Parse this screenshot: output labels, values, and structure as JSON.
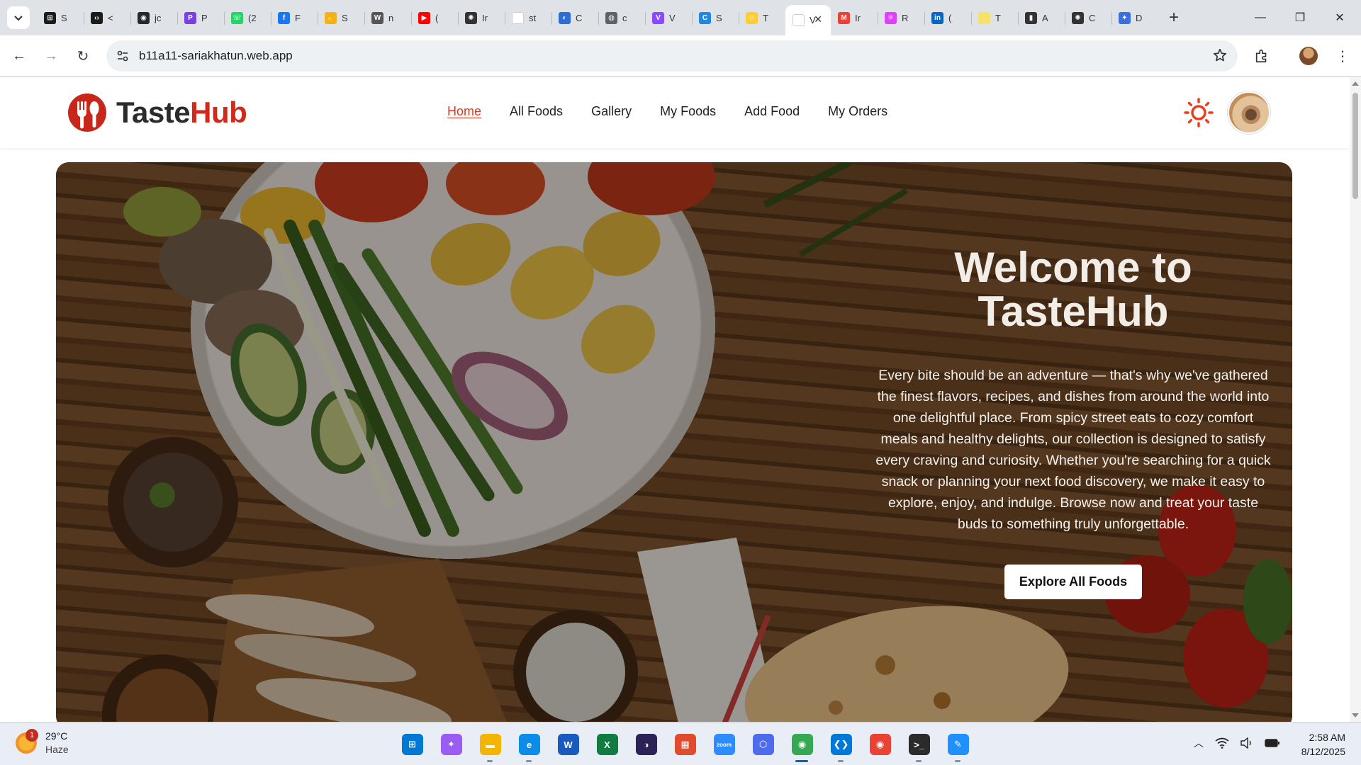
{
  "browser": {
    "tabs": [
      {
        "icon": "codechef-icon",
        "label": "S",
        "color": "#1b1b1b",
        "glyph": "⊞"
      },
      {
        "icon": "code-icon",
        "label": "<",
        "color": "#1b1b1b",
        "glyph": "‹›"
      },
      {
        "icon": "github-icon",
        "label": "jc",
        "color": "#24292e",
        "glyph": "◉"
      },
      {
        "icon": "p-icon",
        "label": "P",
        "color": "#7b3fe4",
        "glyph": "P"
      },
      {
        "icon": "whatsapp-icon",
        "label": "(2",
        "color": "#25d366",
        "glyph": "☏"
      },
      {
        "icon": "facebook-icon",
        "label": "F",
        "color": "#1877f2",
        "glyph": "f"
      },
      {
        "icon": "hands-icon",
        "label": "S",
        "color": "#f2b21b",
        "glyph": "✋"
      },
      {
        "icon": "wordpress-icon",
        "label": "n",
        "color": "#555555",
        "glyph": "W"
      },
      {
        "icon": "youtube-icon",
        "label": "(",
        "color": "#ff0000",
        "glyph": "▶"
      },
      {
        "icon": "openai-icon",
        "label": "Ir",
        "color": "#333333",
        "glyph": "✺"
      },
      {
        "icon": "blank-page-icon",
        "label": "st",
        "color": "#ffffff",
        "glyph": ""
      },
      {
        "icon": "copilot-icon",
        "label": "C",
        "color": "#2b6fd6",
        "glyph": "◐"
      },
      {
        "icon": "globe-icon",
        "label": "c",
        "color": "#5f6368",
        "glyph": "◍"
      },
      {
        "icon": "vite-icon",
        "label": "V",
        "color": "#8a4bff",
        "glyph": "V"
      },
      {
        "icon": "c-logo-icon",
        "label": "S",
        "color": "#1e88e5",
        "glyph": "C"
      },
      {
        "icon": "emoji-icon",
        "label": "T",
        "color": "#ffcc33",
        "glyph": "☺"
      },
      {
        "icon": "vite-page-icon",
        "label": "V",
        "color": "#ffffff",
        "glyph": ""
      },
      {
        "icon": "gmail-icon",
        "label": "Ir",
        "color": "#ea4335",
        "glyph": "M"
      },
      {
        "icon": "react-icon",
        "label": "R",
        "color": "#e040fb",
        "glyph": "⚛"
      },
      {
        "icon": "linkedin-icon",
        "label": "(",
        "color": "#0a66c2",
        "glyph": "in"
      },
      {
        "icon": "yellow-dot-icon",
        "label": "T",
        "color": "#f5e26b",
        "glyph": ""
      },
      {
        "icon": "bottle-icon",
        "label": "A",
        "color": "#333333",
        "glyph": "▮"
      },
      {
        "icon": "openai-icon-2",
        "label": "C",
        "color": "#333333",
        "glyph": "✺"
      },
      {
        "icon": "gemini-icon",
        "label": "D",
        "color": "#3b6fe0",
        "glyph": "✦"
      }
    ],
    "active_tab_index": 16,
    "address": "b11a11-sariakhatun.web.app"
  },
  "site": {
    "logo": {
      "part1": "Taste",
      "part2": "Hub"
    },
    "nav": [
      "Home",
      "All Foods",
      "Gallery",
      "My Foods",
      "Add Food",
      "My Orders"
    ],
    "active_nav": "Home"
  },
  "hero": {
    "title": "Welcome to TasteHub",
    "text": "Every bite should be an adventure — that's why we've gathered the finest flavors, recipes, and dishes from around the world into one delightful place. From spicy street eats to cozy comfort meals and healthy delights, our collection is designed to satisfy every craving and curiosity. Whether you're searching for a quick snack or planning your next food discovery, we make it easy to explore, enjoy, and indulge. Browse now and treat your taste buds to something truly unforgettable.",
    "button": "Explore All Foods"
  },
  "taskbar": {
    "weather": {
      "temp": "29°C",
      "condition": "Haze",
      "badge": "1"
    },
    "apps": [
      {
        "name": "start-icon",
        "color": "#0078d4",
        "glyph": "⊞"
      },
      {
        "name": "copilot-app-icon",
        "color": "#9b5cf6",
        "glyph": "✦"
      },
      {
        "name": "file-explorer-icon",
        "color": "#f4b400",
        "glyph": "▬"
      },
      {
        "name": "edge-icon",
        "color": "#0c8ce9",
        "glyph": "e"
      },
      {
        "name": "word-icon",
        "color": "#185abd",
        "glyph": "W"
      },
      {
        "name": "excel-icon",
        "color": "#107c41",
        "glyph": "X"
      },
      {
        "name": "eclipse-icon",
        "color": "#2c2255",
        "glyph": "◑"
      },
      {
        "name": "store-icon",
        "color": "#e04b2d",
        "glyph": "▦"
      },
      {
        "name": "zoom-icon",
        "color": "#2d8cff",
        "glyph": "zoom"
      },
      {
        "name": "hex-app-icon",
        "color": "#4f6bed",
        "glyph": "⬡"
      },
      {
        "name": "chrome-icon",
        "color": "#34a853",
        "glyph": "◉"
      },
      {
        "name": "vscode-icon",
        "color": "#0078d7",
        "glyph": "❮❯"
      },
      {
        "name": "chrome-beta-icon",
        "color": "#ea4335",
        "glyph": "◉"
      },
      {
        "name": "terminal-icon",
        "color": "#2b2b2b",
        "glyph": ">_"
      },
      {
        "name": "paint-icon",
        "color": "#1e90ff",
        "glyph": "✎"
      }
    ],
    "active_app_index": 10,
    "clock": {
      "time": "2:58 AM",
      "date": "8/12/2025"
    }
  }
}
